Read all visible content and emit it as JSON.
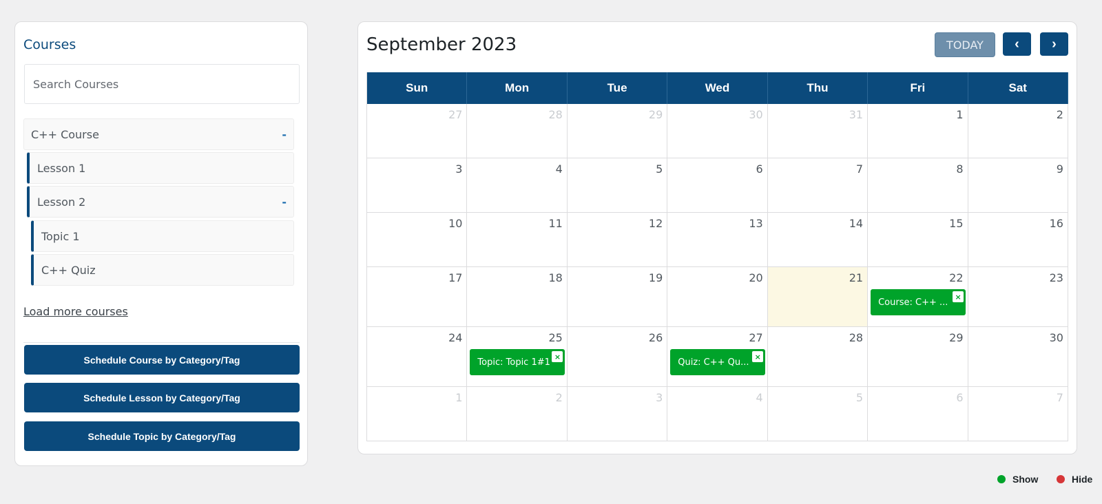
{
  "sidebar": {
    "title": "Courses",
    "search_placeholder": "Search Courses",
    "tree": [
      {
        "label": "C++ Course",
        "collapse": "-"
      },
      {
        "label": "Lesson 1",
        "collapse": ""
      },
      {
        "label": "Lesson 2",
        "collapse": "-"
      },
      {
        "label": "Topic 1",
        "collapse": ""
      },
      {
        "label": "C++ Quiz",
        "collapse": ""
      }
    ],
    "load_more": "Load more courses",
    "buttons": [
      "Schedule Course by Category/Tag",
      "Schedule Lesson by Category/Tag",
      "Schedule Topic by Category/Tag"
    ]
  },
  "calendar": {
    "title": "September 2023",
    "today_label": "TODAY",
    "prev_icon": "‹",
    "next_icon": "›",
    "weekdays": [
      "Sun",
      "Mon",
      "Tue",
      "Wed",
      "Thu",
      "Fri",
      "Sat"
    ],
    "today_date": "21",
    "weeks": [
      [
        {
          "d": "27",
          "o": true
        },
        {
          "d": "28",
          "o": true
        },
        {
          "d": "29",
          "o": true
        },
        {
          "d": "30",
          "o": true
        },
        {
          "d": "31",
          "o": true
        },
        {
          "d": "1"
        },
        {
          "d": "2"
        }
      ],
      [
        {
          "d": "3"
        },
        {
          "d": "4"
        },
        {
          "d": "5"
        },
        {
          "d": "6"
        },
        {
          "d": "7"
        },
        {
          "d": "8"
        },
        {
          "d": "9"
        }
      ],
      [
        {
          "d": "10"
        },
        {
          "d": "11"
        },
        {
          "d": "12"
        },
        {
          "d": "13"
        },
        {
          "d": "14"
        },
        {
          "d": "15"
        },
        {
          "d": "16"
        }
      ],
      [
        {
          "d": "17"
        },
        {
          "d": "18"
        },
        {
          "d": "19"
        },
        {
          "d": "20"
        },
        {
          "d": "21",
          "today": true
        },
        {
          "d": "22",
          "event": "Course: C++ ..."
        },
        {
          "d": "23"
        }
      ],
      [
        {
          "d": "24"
        },
        {
          "d": "25",
          "event": "Topic: Topic 1#1"
        },
        {
          "d": "26"
        },
        {
          "d": "27",
          "event": "Quiz: C++ Qu..."
        },
        {
          "d": "28"
        },
        {
          "d": "29"
        },
        {
          "d": "30"
        }
      ],
      [
        {
          "d": "1",
          "o": true
        },
        {
          "d": "2",
          "o": true
        },
        {
          "d": "3",
          "o": true
        },
        {
          "d": "4",
          "o": true
        },
        {
          "d": "5",
          "o": true
        },
        {
          "d": "6",
          "o": true
        },
        {
          "d": "7",
          "o": true
        }
      ]
    ],
    "event_close_icon": "×"
  },
  "legend": {
    "show_label": "Show",
    "hide_label": "Hide",
    "show_color": "#00a32a",
    "hide_color": "#d63638"
  }
}
